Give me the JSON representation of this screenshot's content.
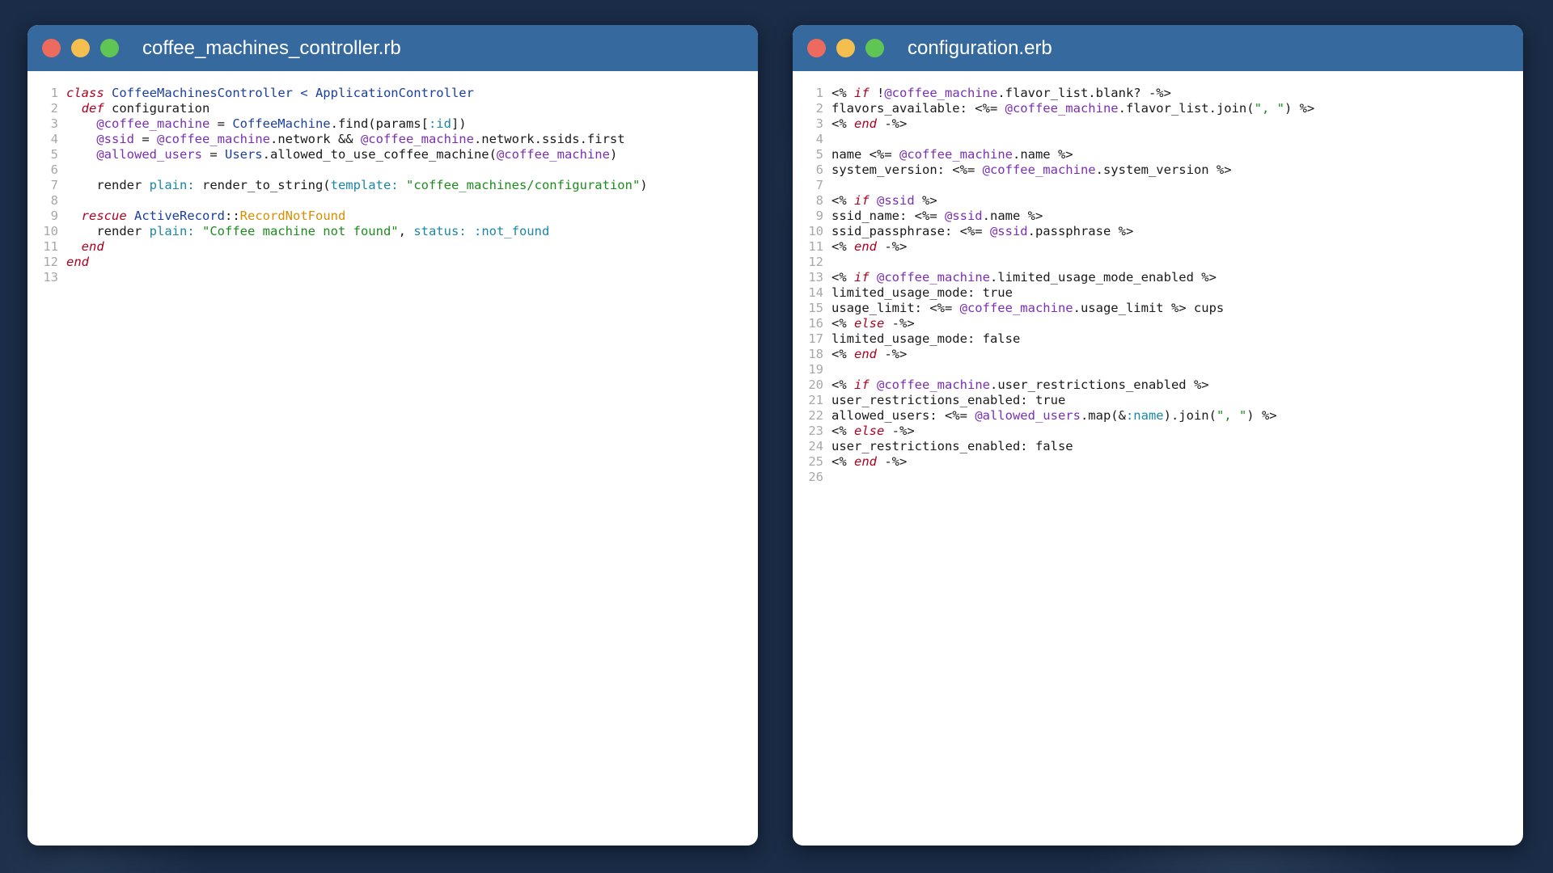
{
  "left_window": {
    "title": "coffee_machines_controller.rb",
    "lines": [
      {
        "n": "1",
        "tokens": [
          [
            "kw",
            "class"
          ],
          [
            "t",
            " "
          ],
          [
            "cn",
            "CoffeeMachinesController < ApplicationController"
          ]
        ]
      },
      {
        "n": "2",
        "tokens": [
          [
            "t",
            "  "
          ],
          [
            "kw",
            "def"
          ],
          [
            "t",
            " configuration"
          ]
        ]
      },
      {
        "n": "3",
        "tokens": [
          [
            "t",
            "    "
          ],
          [
            "iv",
            "@coffee_machine"
          ],
          [
            "t",
            " = "
          ],
          [
            "cn",
            "CoffeeMachine"
          ],
          [
            "t",
            ".find(params["
          ],
          [
            "sym",
            ":id"
          ],
          [
            "t",
            "])"
          ]
        ]
      },
      {
        "n": "4",
        "tokens": [
          [
            "t",
            "    "
          ],
          [
            "iv",
            "@ssid"
          ],
          [
            "t",
            " = "
          ],
          [
            "iv",
            "@coffee_machine"
          ],
          [
            "t",
            ".network && "
          ],
          [
            "iv",
            "@coffee_machine"
          ],
          [
            "t",
            ".network.ssids.first"
          ]
        ]
      },
      {
        "n": "5",
        "tokens": [
          [
            "t",
            "    "
          ],
          [
            "iv",
            "@allowed_users"
          ],
          [
            "t",
            " = "
          ],
          [
            "cn",
            "Users"
          ],
          [
            "t",
            ".allowed_to_use_coffee_machine("
          ],
          [
            "iv",
            "@coffee_machine"
          ],
          [
            "t",
            ")"
          ]
        ]
      },
      {
        "n": "6",
        "tokens": []
      },
      {
        "n": "7",
        "tokens": [
          [
            "t",
            "    render "
          ],
          [
            "sym",
            "plain:"
          ],
          [
            "t",
            " render_to_string("
          ],
          [
            "sym",
            "template:"
          ],
          [
            "t",
            " "
          ],
          [
            "str",
            "\"coffee_machines/configuration\""
          ],
          [
            "t",
            ")"
          ]
        ]
      },
      {
        "n": "8",
        "tokens": []
      },
      {
        "n": "9",
        "tokens": [
          [
            "t",
            "  "
          ],
          [
            "kw",
            "rescue"
          ],
          [
            "t",
            " "
          ],
          [
            "cn",
            "ActiveRecord"
          ],
          [
            "t",
            "::"
          ],
          [
            "exc",
            "RecordNotFound"
          ]
        ]
      },
      {
        "n": "10",
        "tokens": [
          [
            "t",
            "    render "
          ],
          [
            "sym",
            "plain:"
          ],
          [
            "t",
            " "
          ],
          [
            "str",
            "\"Coffee machine not found\""
          ],
          [
            "t",
            ", "
          ],
          [
            "sym",
            "status:"
          ],
          [
            "t",
            " "
          ],
          [
            "sym",
            ":not_found"
          ]
        ]
      },
      {
        "n": "11",
        "tokens": [
          [
            "t",
            "  "
          ],
          [
            "kw",
            "end"
          ]
        ]
      },
      {
        "n": "12",
        "tokens": [
          [
            "kw",
            "end"
          ]
        ]
      },
      {
        "n": "13",
        "tokens": []
      }
    ]
  },
  "right_window": {
    "title": "configuration.erb",
    "lines": [
      {
        "n": "1",
        "tokens": [
          [
            "t",
            "<% "
          ],
          [
            "kw",
            "if"
          ],
          [
            "t",
            " !"
          ],
          [
            "iv",
            "@coffee_machine"
          ],
          [
            "t",
            ".flavor_list.blank? -%>"
          ]
        ]
      },
      {
        "n": "2",
        "tokens": [
          [
            "t",
            "flavors_available: <%= "
          ],
          [
            "iv",
            "@coffee_machine"
          ],
          [
            "t",
            ".flavor_list.join("
          ],
          [
            "str",
            "\", \""
          ],
          [
            "t",
            ") %>"
          ]
        ]
      },
      {
        "n": "3",
        "tokens": [
          [
            "t",
            "<% "
          ],
          [
            "kw",
            "end"
          ],
          [
            "t",
            " -%>"
          ]
        ]
      },
      {
        "n": "4",
        "tokens": []
      },
      {
        "n": "5",
        "tokens": [
          [
            "t",
            "name <%= "
          ],
          [
            "iv",
            "@coffee_machine"
          ],
          [
            "t",
            ".name %>"
          ]
        ]
      },
      {
        "n": "6",
        "tokens": [
          [
            "t",
            "system_version: <%= "
          ],
          [
            "iv",
            "@coffee_machine"
          ],
          [
            "t",
            ".system_version %>"
          ]
        ]
      },
      {
        "n": "7",
        "tokens": []
      },
      {
        "n": "8",
        "tokens": [
          [
            "t",
            "<% "
          ],
          [
            "kw",
            "if"
          ],
          [
            "t",
            " "
          ],
          [
            "iv",
            "@ssid"
          ],
          [
            "t",
            " %>"
          ]
        ]
      },
      {
        "n": "9",
        "tokens": [
          [
            "t",
            "ssid_name: <%= "
          ],
          [
            "iv",
            "@ssid"
          ],
          [
            "t",
            ".name %>"
          ]
        ]
      },
      {
        "n": "10",
        "tokens": [
          [
            "t",
            "ssid_passphrase: <%= "
          ],
          [
            "iv",
            "@ssid"
          ],
          [
            "t",
            ".passphrase %>"
          ]
        ]
      },
      {
        "n": "11",
        "tokens": [
          [
            "t",
            "<% "
          ],
          [
            "kw",
            "end"
          ],
          [
            "t",
            " -%>"
          ]
        ]
      },
      {
        "n": "12",
        "tokens": []
      },
      {
        "n": "13",
        "tokens": [
          [
            "t",
            "<% "
          ],
          [
            "kw",
            "if"
          ],
          [
            "t",
            " "
          ],
          [
            "iv",
            "@coffee_machine"
          ],
          [
            "t",
            ".limited_usage_mode_enabled %>"
          ]
        ]
      },
      {
        "n": "14",
        "tokens": [
          [
            "t",
            "limited_usage_mode: true"
          ]
        ]
      },
      {
        "n": "15",
        "tokens": [
          [
            "t",
            "usage_limit: <%= "
          ],
          [
            "iv",
            "@coffee_machine"
          ],
          [
            "t",
            ".usage_limit %> cups"
          ]
        ]
      },
      {
        "n": "16",
        "tokens": [
          [
            "t",
            "<% "
          ],
          [
            "kw",
            "else"
          ],
          [
            "t",
            " -%>"
          ]
        ]
      },
      {
        "n": "17",
        "tokens": [
          [
            "t",
            "limited_usage_mode: false"
          ]
        ]
      },
      {
        "n": "18",
        "tokens": [
          [
            "t",
            "<% "
          ],
          [
            "kw",
            "end"
          ],
          [
            "t",
            " -%>"
          ]
        ]
      },
      {
        "n": "19",
        "tokens": []
      },
      {
        "n": "20",
        "tokens": [
          [
            "t",
            "<% "
          ],
          [
            "kw",
            "if"
          ],
          [
            "t",
            " "
          ],
          [
            "iv",
            "@coffee_machine"
          ],
          [
            "t",
            ".user_restrictions_enabled %>"
          ]
        ]
      },
      {
        "n": "21",
        "tokens": [
          [
            "t",
            "user_restrictions_enabled: true"
          ]
        ]
      },
      {
        "n": "22",
        "tokens": [
          [
            "t",
            "allowed_users: <%= "
          ],
          [
            "iv",
            "@allowed_users"
          ],
          [
            "t",
            ".map(&"
          ],
          [
            "sym",
            ":name"
          ],
          [
            "t",
            ").join("
          ],
          [
            "str",
            "\", \""
          ],
          [
            "t",
            ") %>"
          ]
        ]
      },
      {
        "n": "23",
        "tokens": [
          [
            "t",
            "<% "
          ],
          [
            "kw",
            "else"
          ],
          [
            "t",
            " -%>"
          ]
        ]
      },
      {
        "n": "24",
        "tokens": [
          [
            "t",
            "user_restrictions_enabled: false"
          ]
        ]
      },
      {
        "n": "25",
        "tokens": [
          [
            "t",
            "<% "
          ],
          [
            "kw",
            "end"
          ],
          [
            "t",
            " -%>"
          ]
        ]
      },
      {
        "n": "26",
        "tokens": []
      }
    ]
  },
  "colors": {
    "titlebar": "#366a9f",
    "keyword": "#b0001f",
    "constant": "#1a3fa0",
    "instance_variable": "#7a2fb4",
    "symbol": "#1a87a6",
    "string": "#1d8c1d",
    "exception": "#d98e00"
  }
}
